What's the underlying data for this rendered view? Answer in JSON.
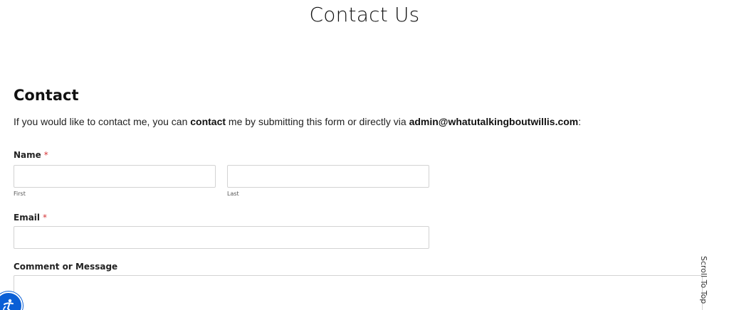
{
  "page": {
    "title": "Contact Us"
  },
  "contact": {
    "heading": "Contact",
    "intro": {
      "part1": "If you would like to contact me, you can ",
      "bold1": "contact",
      "part2": " me by submitting this form or directly via ",
      "bold2": "admin@whatutalkingboutwillis.com",
      "part3": ":"
    }
  },
  "form": {
    "name": {
      "label": "Name",
      "required_marker": "*",
      "first": {
        "value": "",
        "sublabel": "First"
      },
      "last": {
        "value": "",
        "sublabel": "Last"
      }
    },
    "email": {
      "label": "Email",
      "required_marker": "*",
      "value": ""
    },
    "message": {
      "label": "Comment or Message",
      "value": ""
    }
  },
  "scroll_to_top": {
    "label": "Scroll To Top"
  },
  "accessibility": {
    "icon": "accessibility-icon",
    "color": "#0a5fd6"
  }
}
